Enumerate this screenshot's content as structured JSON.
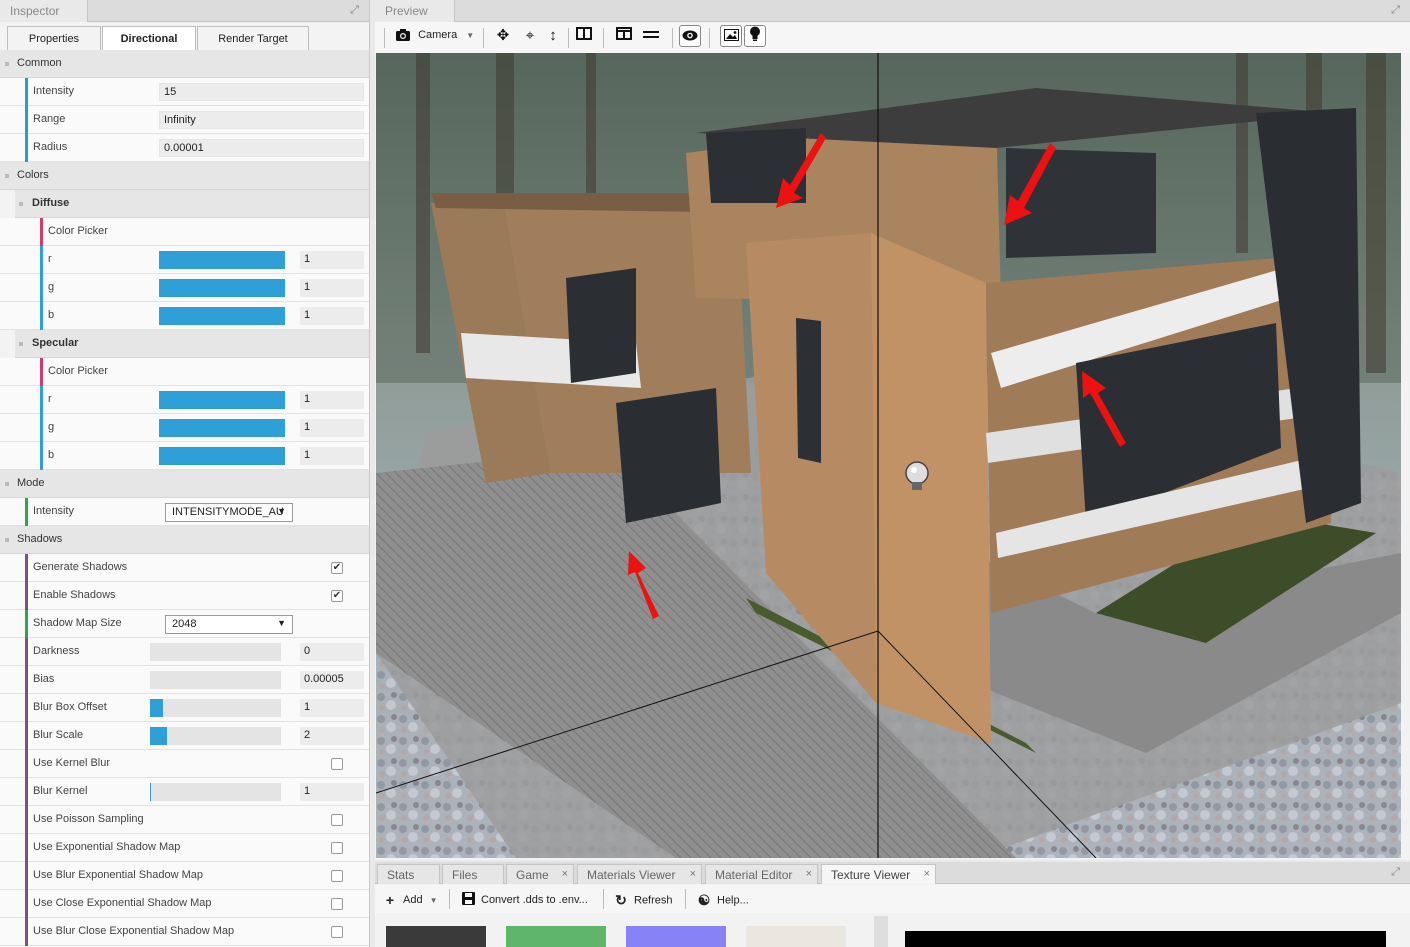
{
  "inspector": {
    "title": "Inspector",
    "tabs": [
      {
        "label": "Properties",
        "active": false
      },
      {
        "label": "Directional",
        "active": true
      },
      {
        "label": "Render Target",
        "active": false
      }
    ],
    "common": {
      "title": "Common",
      "intensity_label": "Intensity",
      "intensity_value": "15",
      "range_label": "Range",
      "range_value": "Infinity",
      "radius_label": "Radius",
      "radius_value": "0.00001"
    },
    "colors": {
      "title": "Colors",
      "diffuse": {
        "title": "Diffuse",
        "picker_label": "Color Picker",
        "r_label": "r",
        "r": "1",
        "g_label": "g",
        "g": "1",
        "b_label": "b",
        "b": "1"
      },
      "specular": {
        "title": "Specular",
        "picker_label": "Color Picker",
        "r_label": "r",
        "r": "1",
        "g_label": "g",
        "g": "1",
        "b_label": "b",
        "b": "1"
      }
    },
    "mode": {
      "title": "Mode",
      "intensity_label": "Intensity",
      "intensity_value": "INTENSITYMODE_AU"
    },
    "shadows": {
      "title": "Shadows",
      "generate_shadows_label": "Generate Shadows",
      "generate_shadows": true,
      "enable_shadows_label": "Enable Shadows",
      "enable_shadows": true,
      "shadow_map_size_label": "Shadow Map Size",
      "shadow_map_size": "2048",
      "darkness_label": "Darkness",
      "darkness": "0",
      "darkness_fill": 0,
      "bias_label": "Bias",
      "bias": "0.00005",
      "bias_fill": 0,
      "blur_box_offset_label": "Blur Box Offset",
      "blur_box_offset": "1",
      "blur_box_offset_fill": 0.1,
      "blur_scale_label": "Blur Scale",
      "blur_scale": "2",
      "blur_scale_fill": 0.13,
      "use_kernel_blur_label": "Use Kernel Blur",
      "use_kernel_blur": false,
      "blur_kernel_label": "Blur Kernel",
      "blur_kernel": "1",
      "blur_kernel_fill": 0.01,
      "use_poisson_label": "Use Poisson Sampling",
      "use_poisson": false,
      "use_exp_label": "Use Exponential Shadow Map",
      "use_exp": false,
      "use_blur_exp_label": "Use Blur Exponential Shadow Map",
      "use_blur_exp": false,
      "use_close_exp_label": "Use Close Exponential Shadow Map",
      "use_close_exp": false,
      "use_blur_close_exp_label": "Use Blur Close Exponential Shadow Map",
      "use_blur_close_exp": false
    }
  },
  "preview": {
    "title": "Preview",
    "camera_label": "Camera"
  },
  "bottom": {
    "tabs": [
      {
        "label": "Stats",
        "closable": false,
        "active": false
      },
      {
        "label": "Files",
        "closable": false,
        "active": false
      },
      {
        "label": "Game",
        "closable": true,
        "active": false
      },
      {
        "label": "Materials Viewer",
        "closable": true,
        "active": false
      },
      {
        "label": "Material Editor",
        "closable": true,
        "active": false
      },
      {
        "label": "Texture Viewer",
        "closable": true,
        "active": true
      }
    ],
    "toolbar": {
      "add_label": "Add",
      "convert_label": "Convert .dds to .env...",
      "refresh_label": "Refresh",
      "help_label": "Help..."
    }
  },
  "colors": {
    "accent_blue": "#2f9fd7",
    "common_bar": "#1fa0d0",
    "colors_bar": "#d63a6a",
    "mode_bar": "#2ca84a",
    "shadows_bar": "#7a4f8a"
  }
}
